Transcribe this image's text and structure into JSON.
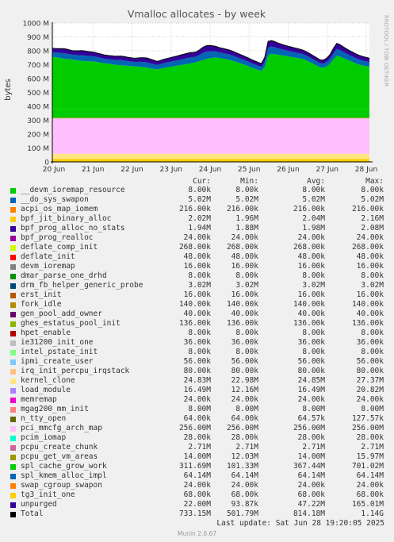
{
  "chart_data": {
    "type": "area",
    "title": "Vmalloc allocates - by week",
    "ylabel": "bytes",
    "side_label": "RRDTOOL / TOBI OETIKER",
    "y_ticks": [
      "0",
      "100 M",
      "200 M",
      "300 M",
      "400 M",
      "500 M",
      "600 M",
      "700 M",
      "800 M",
      "900 M",
      "1000 M"
    ],
    "ylim": [
      0,
      1000
    ],
    "x_ticks": [
      "20 Jun",
      "21 Jun",
      "22 Jun",
      "23 Jun",
      "24 Jun",
      "25 Jun",
      "26 Jun",
      "27 Jun",
      "28 Jun"
    ],
    "grid": true,
    "baseline_series_mb": {
      "unpurged": 22,
      "pcpu_create_chunk+small": 36,
      "pci_mmcfg_arch_map": 256,
      "spl_kmem_alloc_impl": 64
    },
    "spl_cache_grow_work_mb": [
      380,
      376,
      372,
      368,
      364,
      362,
      360,
      356,
      352,
      350,
      348,
      346,
      346,
      344,
      340,
      336,
      332,
      330,
      326,
      322,
      320,
      318,
      316,
      314,
      312,
      310,
      308,
      306,
      304,
      300,
      296,
      292,
      288,
      292,
      298,
      302,
      306,
      310,
      314,
      318,
      322,
      326,
      330,
      334,
      340,
      348,
      356,
      362,
      368,
      372,
      374,
      370,
      366,
      362,
      358,
      352,
      344,
      336,
      328,
      320,
      310,
      300,
      292,
      284,
      278,
      306,
      390,
      400,
      398,
      394,
      390,
      386,
      382,
      378,
      374,
      370,
      366,
      360,
      350,
      338,
      326,
      314,
      302,
      300,
      310,
      330,
      360,
      386,
      380,
      370,
      360,
      350,
      340,
      330,
      322,
      316,
      312,
      308
    ],
    "total_extra_mb": [
      60,
      62,
      66,
      70,
      72,
      68,
      64,
      66,
      70,
      74,
      72,
      70,
      68,
      66,
      64,
      62,
      60,
      58,
      60,
      62,
      64,
      66,
      64,
      62,
      60,
      58,
      62,
      66,
      68,
      70,
      66,
      62,
      58,
      60,
      62,
      64,
      66,
      68,
      70,
      72,
      74,
      76,
      78,
      76,
      74,
      80,
      90,
      96,
      92,
      86,
      80,
      76,
      74,
      72,
      70,
      68,
      66,
      64,
      62,
      60,
      60,
      58,
      56,
      54,
      52,
      70,
      100,
      96,
      90,
      84,
      80,
      76,
      74,
      72,
      70,
      68,
      66,
      64,
      62,
      60,
      58,
      56,
      54,
      56,
      60,
      66,
      80,
      90,
      86,
      80,
      76,
      72,
      70,
      68,
      66,
      64,
      62,
      60
    ],
    "legend_headers": [
      "Cur:",
      "Min:",
      "Avg:",
      "Max:"
    ],
    "series": [
      {
        "name": "__devm_ioremap_resource",
        "color": "#00cc00",
        "cur": "8.00k",
        "min": "8.00k",
        "avg": "8.00k",
        "max": "8.00k"
      },
      {
        "name": "__do_sys_swapon",
        "color": "#0066b3",
        "cur": "5.02M",
        "min": "5.02M",
        "avg": "5.02M",
        "max": "5.02M"
      },
      {
        "name": "acpi_os_map_iomem",
        "color": "#ff8000",
        "cur": "216.00k",
        "min": "216.00k",
        "avg": "216.00k",
        "max": "216.00k"
      },
      {
        "name": "bpf_jit_binary_alloc",
        "color": "#ffcc00",
        "cur": "2.02M",
        "min": "1.96M",
        "avg": "2.04M",
        "max": "2.16M"
      },
      {
        "name": "bpf_prog_alloc_no_stats",
        "color": "#330099",
        "cur": "1.94M",
        "min": "1.88M",
        "avg": "1.98M",
        "max": "2.08M"
      },
      {
        "name": "bpf_prog_realloc",
        "color": "#990099",
        "cur": "24.00k",
        "min": "24.00k",
        "avg": "24.00k",
        "max": "24.00k"
      },
      {
        "name": "deflate_comp_init",
        "color": "#ccff00",
        "cur": "268.00k",
        "min": "268.00k",
        "avg": "268.00k",
        "max": "268.00k"
      },
      {
        "name": "deflate_init",
        "color": "#ff0000",
        "cur": "48.00k",
        "min": "48.00k",
        "avg": "48.00k",
        "max": "48.00k"
      },
      {
        "name": "devm_ioremap",
        "color": "#808080",
        "cur": "16.00k",
        "min": "16.00k",
        "avg": "16.00k",
        "max": "16.00k"
      },
      {
        "name": "dmar_parse_one_drhd",
        "color": "#008f00",
        "cur": "8.00k",
        "min": "8.00k",
        "avg": "8.00k",
        "max": "8.00k"
      },
      {
        "name": "drm_fb_helper_generic_probe",
        "color": "#00487d",
        "cur": "3.02M",
        "min": "3.02M",
        "avg": "3.02M",
        "max": "3.02M"
      },
      {
        "name": "erst_init",
        "color": "#b35a00",
        "cur": "16.00k",
        "min": "16.00k",
        "avg": "16.00k",
        "max": "16.00k"
      },
      {
        "name": "fork_idle",
        "color": "#b38f00",
        "cur": "140.00k",
        "min": "140.00k",
        "avg": "140.00k",
        "max": "140.00k"
      },
      {
        "name": "gen_pool_add_owner",
        "color": "#6b006b",
        "cur": "40.00k",
        "min": "40.00k",
        "avg": "40.00k",
        "max": "40.00k"
      },
      {
        "name": "ghes_estatus_pool_init",
        "color": "#8fb300",
        "cur": "136.00k",
        "min": "136.00k",
        "avg": "136.00k",
        "max": "136.00k"
      },
      {
        "name": "hpet_enable",
        "color": "#b30000",
        "cur": "8.00k",
        "min": "8.00k",
        "avg": "8.00k",
        "max": "8.00k"
      },
      {
        "name": "ie31200_init_one",
        "color": "#bebebe",
        "cur": "36.00k",
        "min": "36.00k",
        "avg": "36.00k",
        "max": "36.00k"
      },
      {
        "name": "intel_pstate_init",
        "color": "#80ff80",
        "cur": "8.00k",
        "min": "8.00k",
        "avg": "8.00k",
        "max": "8.00k"
      },
      {
        "name": "ipmi_create_user",
        "color": "#80c9ff",
        "cur": "56.00k",
        "min": "56.00k",
        "avg": "56.00k",
        "max": "56.00k"
      },
      {
        "name": "irq_init_percpu_irqstack",
        "color": "#ffc080",
        "cur": "80.00k",
        "min": "80.00k",
        "avg": "80.00k",
        "max": "80.00k"
      },
      {
        "name": "kernel_clone",
        "color": "#ffe680",
        "cur": "24.83M",
        "min": "22.98M",
        "avg": "24.85M",
        "max": "27.37M"
      },
      {
        "name": "load_module",
        "color": "#aa80ff",
        "cur": "16.49M",
        "min": "12.16M",
        "avg": "16.49M",
        "max": "20.82M"
      },
      {
        "name": "memremap",
        "color": "#ee00cc",
        "cur": "24.00k",
        "min": "24.00k",
        "avg": "24.00k",
        "max": "24.00k"
      },
      {
        "name": "mgag200_mm_init",
        "color": "#ff8080",
        "cur": "8.00M",
        "min": "8.00M",
        "avg": "8.00M",
        "max": "8.00M"
      },
      {
        "name": "n_tty_open",
        "color": "#666600",
        "cur": "64.00k",
        "min": "64.00k",
        "avg": "64.57k",
        "max": "127.57k"
      },
      {
        "name": "pci_mmcfg_arch_map",
        "color": "#ffbfff",
        "cur": "256.00M",
        "min": "256.00M",
        "avg": "256.00M",
        "max": "256.00M"
      },
      {
        "name": "pcim_iomap",
        "color": "#00ffcc",
        "cur": "28.00k",
        "min": "28.00k",
        "avg": "28.00k",
        "max": "28.00k"
      },
      {
        "name": "pcpu_create_chunk",
        "color": "#cc6699",
        "cur": "2.71M",
        "min": "2.71M",
        "avg": "2.71M",
        "max": "2.71M"
      },
      {
        "name": "pcpu_get_vm_areas",
        "color": "#999900",
        "cur": "14.00M",
        "min": "12.03M",
        "avg": "14.00M",
        "max": "15.97M"
      },
      {
        "name": "spl_cache_grow_work",
        "color": "#00cc00",
        "cur": "311.69M",
        "min": "101.33M",
        "avg": "367.44M",
        "max": "701.02M"
      },
      {
        "name": "spl_kmem_alloc_impl",
        "color": "#0066b3",
        "cur": "64.14M",
        "min": "64.14M",
        "avg": "64.14M",
        "max": "64.14M"
      },
      {
        "name": "swap_cgroup_swapon",
        "color": "#ff8000",
        "cur": "24.00k",
        "min": "24.00k",
        "avg": "24.00k",
        "max": "24.00k"
      },
      {
        "name": "tg3_init_one",
        "color": "#ffcc00",
        "cur": "68.00k",
        "min": "68.00k",
        "avg": "68.00k",
        "max": "68.00k"
      },
      {
        "name": "unpurged",
        "color": "#330099",
        "cur": "22.00M",
        "min": "93.87k",
        "avg": "47.22M",
        "max": "165.01M"
      },
      {
        "name": "Total",
        "color": "#000000",
        "cur": "733.15M",
        "min": "501.79M",
        "avg": "814.18M",
        "max": "1.14G"
      }
    ]
  },
  "footer": {
    "last_update": "Last update: Sat Jun 28 19:20:05 2025",
    "munin": "Munin 2.0.67"
  }
}
